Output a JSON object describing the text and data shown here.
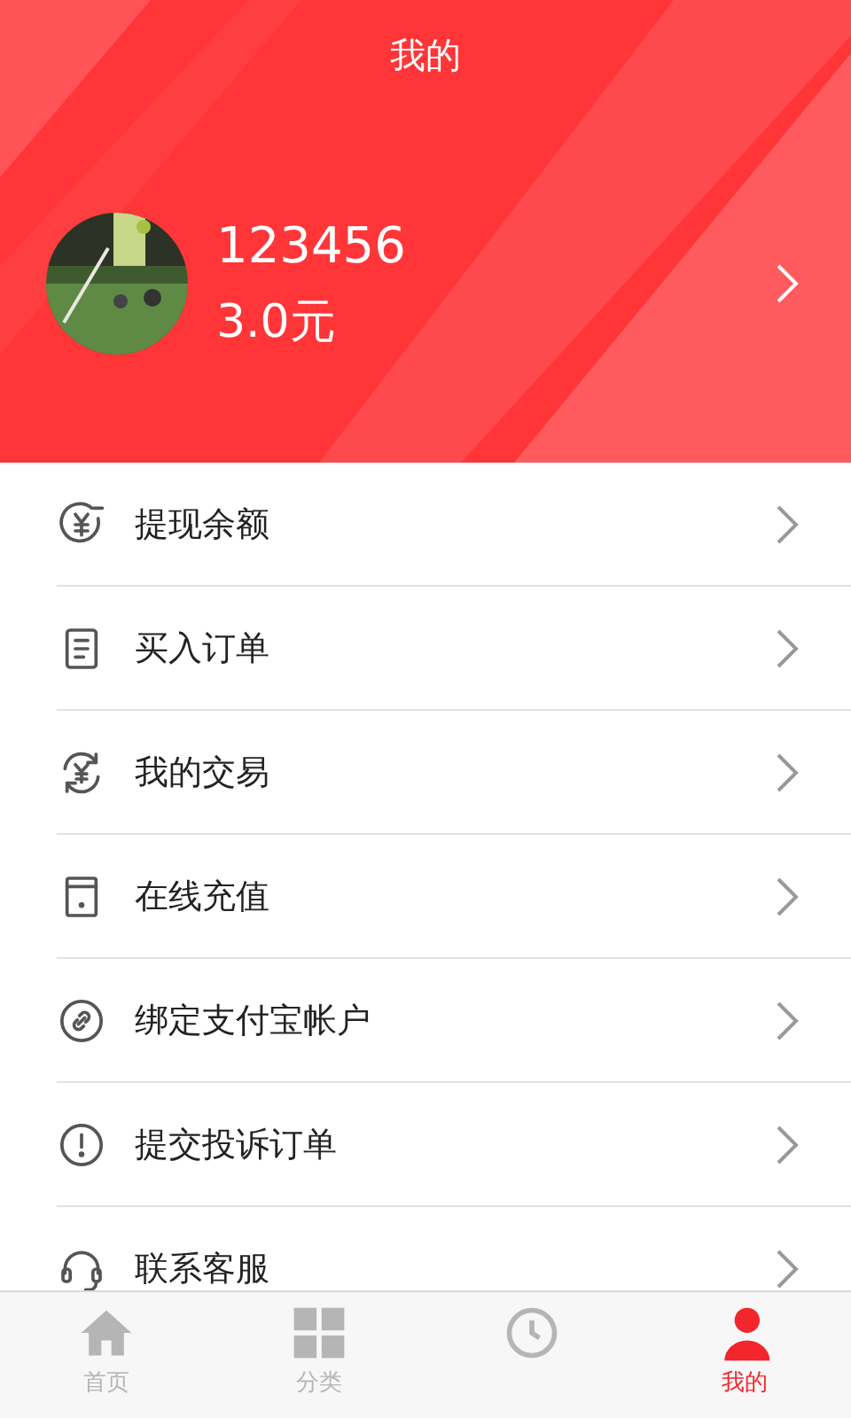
{
  "header": {
    "title": "我的"
  },
  "profile": {
    "kind": "picture",
    "username": "123456",
    "balance": "3.0元"
  },
  "menu": [
    {
      "kind": "withdraw",
      "label": "提现余额"
    },
    {
      "kind": "document",
      "label": "买入订单"
    },
    {
      "kind": "exchange",
      "label": "我的交易"
    },
    {
      "kind": "tablet",
      "label": "在线充值"
    },
    {
      "kind": "link",
      "label": "绑定支付宝帐户"
    },
    {
      "kind": "alert",
      "label": "提交投诉订单"
    },
    {
      "kind": "headset",
      "label": "联系客服"
    }
  ],
  "tabs": [
    {
      "kind": "home",
      "label": "首页",
      "selected": false
    },
    {
      "kind": "grid",
      "label": "分类",
      "selected": false
    },
    {
      "kind": "circle",
      "selected": false
    },
    {
      "kind": "person",
      "label": "我的",
      "selected": true
    }
  ]
}
